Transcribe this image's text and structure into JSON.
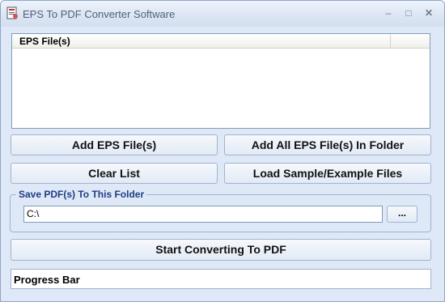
{
  "window": {
    "title": "EPS To PDF Converter Software",
    "controls": {
      "minimize": "–",
      "maximize": "□",
      "close": "✕"
    }
  },
  "file_list": {
    "column_header": "EPS File(s)",
    "items": []
  },
  "buttons": {
    "add_files": "Add EPS File(s)",
    "add_folder": "Add All EPS File(s) In Folder",
    "clear_list": "Clear List",
    "load_samples": "Load Sample/Example Files",
    "start": "Start Converting To PDF"
  },
  "output_folder": {
    "label": "Save PDF(s) To This Folder",
    "value": "C:\\",
    "browse_label": "..."
  },
  "progress": {
    "label": "Progress Bar"
  }
}
